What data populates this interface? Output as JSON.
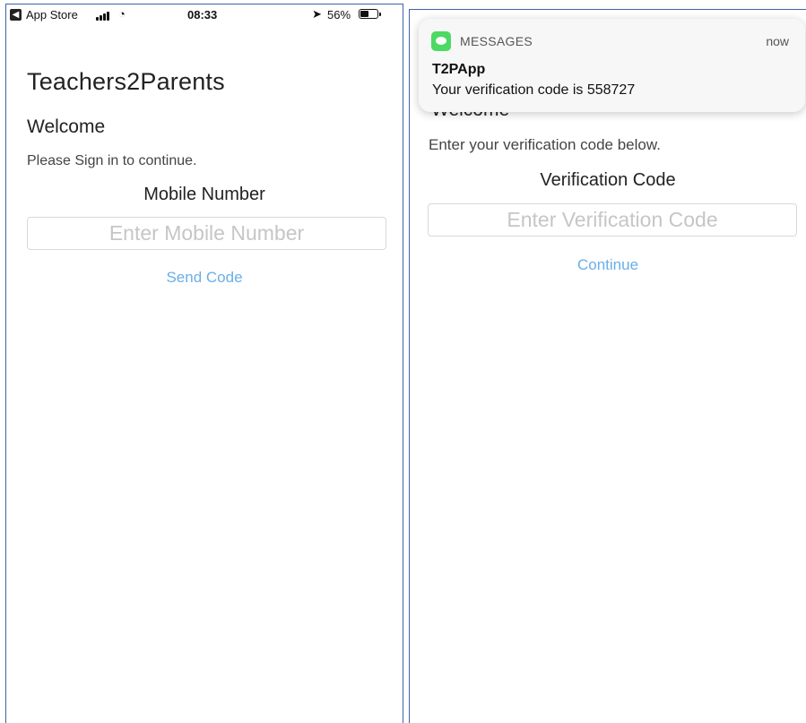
{
  "left_screen": {
    "status_bar": {
      "back_app": "App Store",
      "time": "08:33",
      "battery_percent": "56%",
      "battery_level": 0.56
    },
    "app_title": "Teachers2Parents",
    "welcome": "Welcome",
    "instruction": "Please Sign in to continue.",
    "field_label": "Mobile Number",
    "input_placeholder": "Enter Mobile Number",
    "input_value": "",
    "action_label": "Send Code"
  },
  "right_screen": {
    "welcome_partial": "Welcome",
    "instruction": "Enter your verification code below.",
    "field_label": "Verification Code",
    "input_placeholder": "Enter Verification Code",
    "input_value": "",
    "action_label": "Continue"
  },
  "notification": {
    "app_name": "MESSAGES",
    "time": "now",
    "sender": "T2PApp",
    "message": "Your verification code is 558727"
  },
  "colors": {
    "link": "#6aaee8",
    "messages_icon": "#4cd964",
    "frame_border": "#3f63a8"
  }
}
